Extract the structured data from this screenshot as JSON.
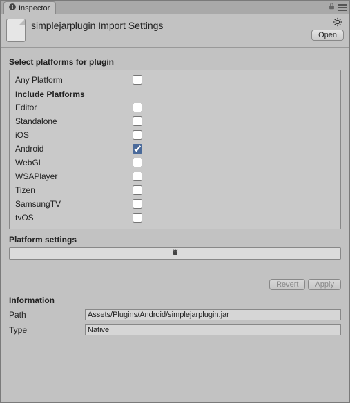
{
  "tab": {
    "label": "Inspector"
  },
  "header": {
    "title": "simplejarplugin Import Settings",
    "open_label": "Open"
  },
  "select_platforms": {
    "title": "Select platforms for plugin",
    "any_platform_label": "Any Platform",
    "any_platform_checked": false,
    "include_title": "Include Platforms",
    "items": [
      {
        "label": "Editor",
        "checked": false
      },
      {
        "label": "Standalone",
        "checked": false
      },
      {
        "label": "iOS",
        "checked": false
      },
      {
        "label": "Android",
        "checked": true
      },
      {
        "label": "WebGL",
        "checked": false
      },
      {
        "label": "WSAPlayer",
        "checked": false
      },
      {
        "label": "Tizen",
        "checked": false
      },
      {
        "label": "SamsungTV",
        "checked": false
      },
      {
        "label": "tvOS",
        "checked": false
      }
    ]
  },
  "platform_settings": {
    "title": "Platform settings"
  },
  "buttons": {
    "revert": "Revert",
    "apply": "Apply"
  },
  "information": {
    "title": "Information",
    "path_label": "Path",
    "path_value": "Assets/Plugins/Android/simplejarplugin.jar",
    "type_label": "Type",
    "type_value": "Native"
  }
}
